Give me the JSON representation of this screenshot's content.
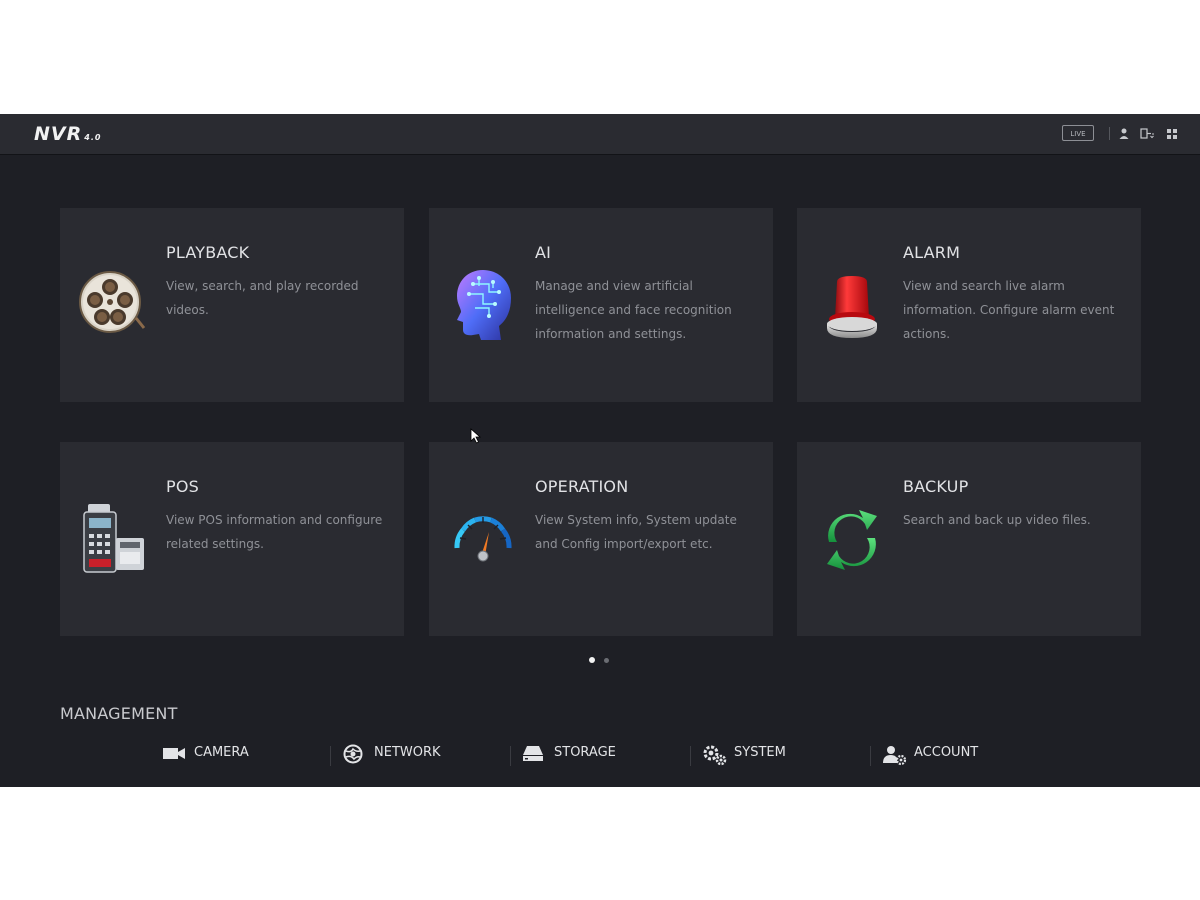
{
  "header": {
    "logo": "NVR",
    "logo_version": "4.0",
    "live_label": "LIVE",
    "icons": [
      "user-icon",
      "logout-icon",
      "grid-icon"
    ]
  },
  "cards": [
    {
      "title": "PLAYBACK",
      "desc": "View, search, and play recorded videos.",
      "icon": "film-reel-icon"
    },
    {
      "title": "AI",
      "desc": "Manage and view artificial intelligence and face recognition information and settings.",
      "icon": "ai-head-icon"
    },
    {
      "title": "ALARM",
      "desc": "View and search live alarm information. Configure alarm event actions.",
      "icon": "alarm-light-icon"
    },
    {
      "title": "POS",
      "desc": "View POS information and configure related settings.",
      "icon": "pos-terminal-icon"
    },
    {
      "title": "OPERATION",
      "desc": "View System info, System update and Config import/export etc.",
      "icon": "gauge-icon"
    },
    {
      "title": "BACKUP",
      "desc": "Search and back up video files.",
      "icon": "refresh-arrows-icon"
    }
  ],
  "pagination": {
    "pages": 2,
    "current": 1
  },
  "management": {
    "title": "MANAGEMENT",
    "items": [
      {
        "label": "CAMERA",
        "icon": "camera-icon"
      },
      {
        "label": "NETWORK",
        "icon": "network-globe-icon"
      },
      {
        "label": "STORAGE",
        "icon": "storage-drive-icon"
      },
      {
        "label": "SYSTEM",
        "icon": "gears-icon"
      },
      {
        "label": "ACCOUNT",
        "icon": "account-gear-icon"
      }
    ]
  },
  "colors": {
    "background": "#1e1f25",
    "card": "#2a2b31",
    "text_primary": "#e1e2e5",
    "text_secondary": "#8f9197",
    "alarm_red": "#d7141b",
    "backup_green": "#2fbf5a",
    "gauge_blue": "#1e9fe0"
  }
}
